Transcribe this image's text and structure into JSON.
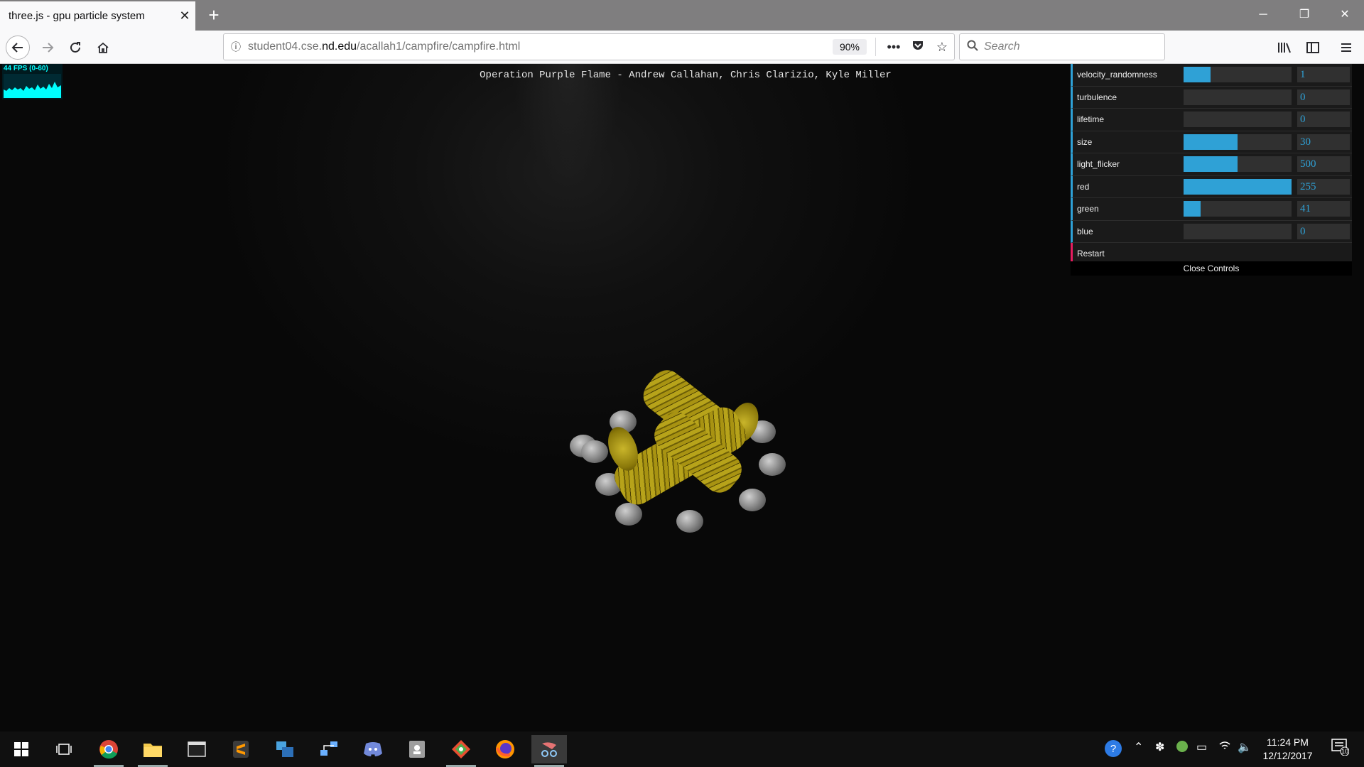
{
  "browser": {
    "tab_title": "three.js - gpu particle system",
    "tab_close": "✕",
    "new_tab": "+",
    "url_host_pre": "student04.cse.",
    "url_host_main": "nd.edu",
    "url_path": "/acallah1/campfire/campfire.html",
    "zoom": "90%",
    "search_placeholder": "Search"
  },
  "page": {
    "heading": "Operation Purple Flame - Andrew Callahan, Chris Clarizio, Kyle Miller",
    "stats_label": "44 FPS (0-60)"
  },
  "gui": {
    "controls": [
      {
        "name": "velocity_randomness",
        "value": "1",
        "fill": 0.25
      },
      {
        "name": "turbulence",
        "value": "0",
        "fill": 0
      },
      {
        "name": "lifetime",
        "value": "0",
        "fill": 0
      },
      {
        "name": "size",
        "value": "30",
        "fill": 0.5
      },
      {
        "name": "light_flicker",
        "value": "500",
        "fill": 0.5
      },
      {
        "name": "red",
        "value": "255",
        "fill": 1.0
      },
      {
        "name": "green",
        "value": "41",
        "fill": 0.16
      },
      {
        "name": "blue",
        "value": "0",
        "fill": 0
      }
    ],
    "restart_label": "Restart",
    "close_label": "Close Controls",
    "accent_color": "#2fa1d6",
    "function_color": "#e61d5f"
  },
  "taskbar": {
    "time": "11:24 PM",
    "date": "12/12/2017",
    "notification_count": "10"
  }
}
